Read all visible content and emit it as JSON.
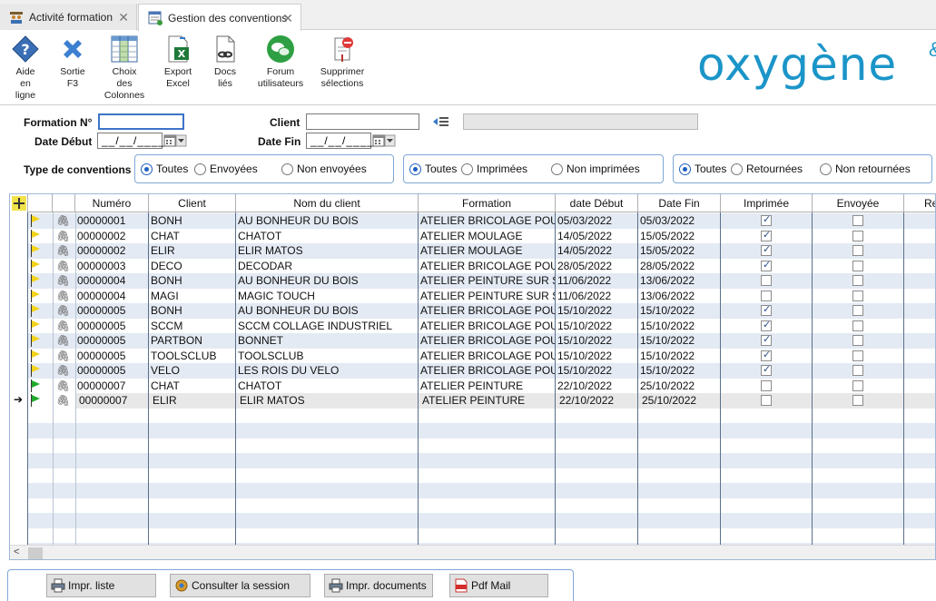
{
  "tabs": [
    {
      "label": "Activité formation",
      "active": false
    },
    {
      "label": "Gestion des conventions",
      "active": true
    }
  ],
  "toolbar": {
    "aide": "Aide\nen\nligne",
    "sortie": "Sortie\nF3",
    "choix": "Choix\ndes\nColonnes",
    "export": "Export\nExcel",
    "docs": "Docs\nliés",
    "forum": "Forum\nutilisateurs",
    "supprimer": "Supprimer\nsélections"
  },
  "logo": {
    "text": "oxygène",
    "mark": "&"
  },
  "filters": {
    "formation_label": "Formation N°",
    "formation_value": "",
    "client_label": "Client",
    "client_value": "",
    "client_name_value": "",
    "date_debut_label": "Date Début",
    "date_debut_value": "__/__/____",
    "date_fin_label": "Date Fin",
    "date_fin_value": "__/__/____",
    "type_label": "Type de conventions",
    "groups": [
      {
        "options": [
          "Toutes",
          "Envoyées",
          "Non envoyées"
        ],
        "selected": 0
      },
      {
        "options": [
          "Toutes",
          "Imprimées",
          "Non imprimées"
        ],
        "selected": 0
      },
      {
        "options": [
          "Toutes",
          "Retournées",
          "Non retournées"
        ],
        "selected": 0
      }
    ]
  },
  "grid": {
    "columns": [
      "Numéro",
      "Client",
      "Nom du client",
      "Formation",
      "date Début",
      "Date Fin",
      "Imprimée",
      "Envoyée",
      "Re"
    ],
    "rows": [
      {
        "flag": "yellow",
        "numero": "00000001",
        "client": "BONH",
        "nom": "AU BONHEUR DU BOIS",
        "formation": "ATELIER BRICOLAGE POU",
        "debut": "05/03/2022",
        "fin": "05/03/2022",
        "imprimee": true,
        "envoyee": false
      },
      {
        "flag": "yellow",
        "numero": "00000002",
        "client": "CHAT",
        "nom": "CHATOT",
        "formation": "ATELIER MOULAGE",
        "debut": "14/05/2022",
        "fin": "15/05/2022",
        "imprimee": true,
        "envoyee": false
      },
      {
        "flag": "yellow",
        "numero": "00000002",
        "client": "ELIR",
        "nom": "ELIR MATOS",
        "formation": "ATELIER MOULAGE",
        "debut": "14/05/2022",
        "fin": "15/05/2022",
        "imprimee": true,
        "envoyee": false
      },
      {
        "flag": "yellow",
        "numero": "00000003",
        "client": "DECO",
        "nom": "DECODAR",
        "formation": "ATELIER BRICOLAGE POU",
        "debut": "28/05/2022",
        "fin": "28/05/2022",
        "imprimee": true,
        "envoyee": false
      },
      {
        "flag": "yellow",
        "numero": "00000004",
        "client": "BONH",
        "nom": "AU BONHEUR DU BOIS",
        "formation": "ATELIER PEINTURE SUR S",
        "debut": "11/06/2022",
        "fin": "13/06/2022",
        "imprimee": false,
        "envoyee": false
      },
      {
        "flag": "yellow",
        "numero": "00000004",
        "client": "MAGI",
        "nom": "MAGIC TOUCH",
        "formation": "ATELIER PEINTURE SUR S",
        "debut": "11/06/2022",
        "fin": "13/06/2022",
        "imprimee": false,
        "envoyee": false
      },
      {
        "flag": "yellow",
        "numero": "00000005",
        "client": "BONH",
        "nom": "AU BONHEUR DU BOIS",
        "formation": "ATELIER BRICOLAGE POU",
        "debut": "15/10/2022",
        "fin": "15/10/2022",
        "imprimee": true,
        "envoyee": false
      },
      {
        "flag": "yellow",
        "numero": "00000005",
        "client": "SCCM",
        "nom": "SCCM COLLAGE INDUSTRIEL",
        "formation": "ATELIER BRICOLAGE POU",
        "debut": "15/10/2022",
        "fin": "15/10/2022",
        "imprimee": true,
        "envoyee": false
      },
      {
        "flag": "yellow",
        "numero": "00000005",
        "client": "PARTBON",
        "nom": "BONNET",
        "formation": "ATELIER BRICOLAGE POU",
        "debut": "15/10/2022",
        "fin": "15/10/2022",
        "imprimee": true,
        "envoyee": false
      },
      {
        "flag": "yellow",
        "numero": "00000005",
        "client": "TOOLSCLUB",
        "nom": "TOOLSCLUB",
        "formation": "ATELIER BRICOLAGE POU",
        "debut": "15/10/2022",
        "fin": "15/10/2022",
        "imprimee": true,
        "envoyee": false
      },
      {
        "flag": "yellow",
        "numero": "00000005",
        "client": "VELO",
        "nom": "LES ROIS DU VELO",
        "formation": "ATELIER BRICOLAGE POU",
        "debut": "15/10/2022",
        "fin": "15/10/2022",
        "imprimee": true,
        "envoyee": false
      },
      {
        "flag": "green",
        "numero": "00000007",
        "client": "CHAT",
        "nom": "CHATOT",
        "formation": "ATELIER PEINTURE",
        "debut": "22/10/2022",
        "fin": "25/10/2022",
        "imprimee": false,
        "envoyee": false
      },
      {
        "flag": "green",
        "numero": "00000007",
        "client": "ELIR",
        "nom": "ELIR MATOS",
        "formation": "ATELIER PEINTURE",
        "debut": "22/10/2022",
        "fin": "25/10/2022",
        "imprimee": false,
        "envoyee": false,
        "selected": true
      }
    ],
    "empty_rows": 10
  },
  "bottom": {
    "impr_liste": "Impr. liste",
    "consulter": "Consulter la session",
    "impr_docs": "Impr. documents",
    "pdf_mail": "Pdf Mail"
  },
  "colors": {
    "accent": "#1b95c8",
    "border": "#7fa7d6",
    "stripe": "#e3eaf3"
  }
}
